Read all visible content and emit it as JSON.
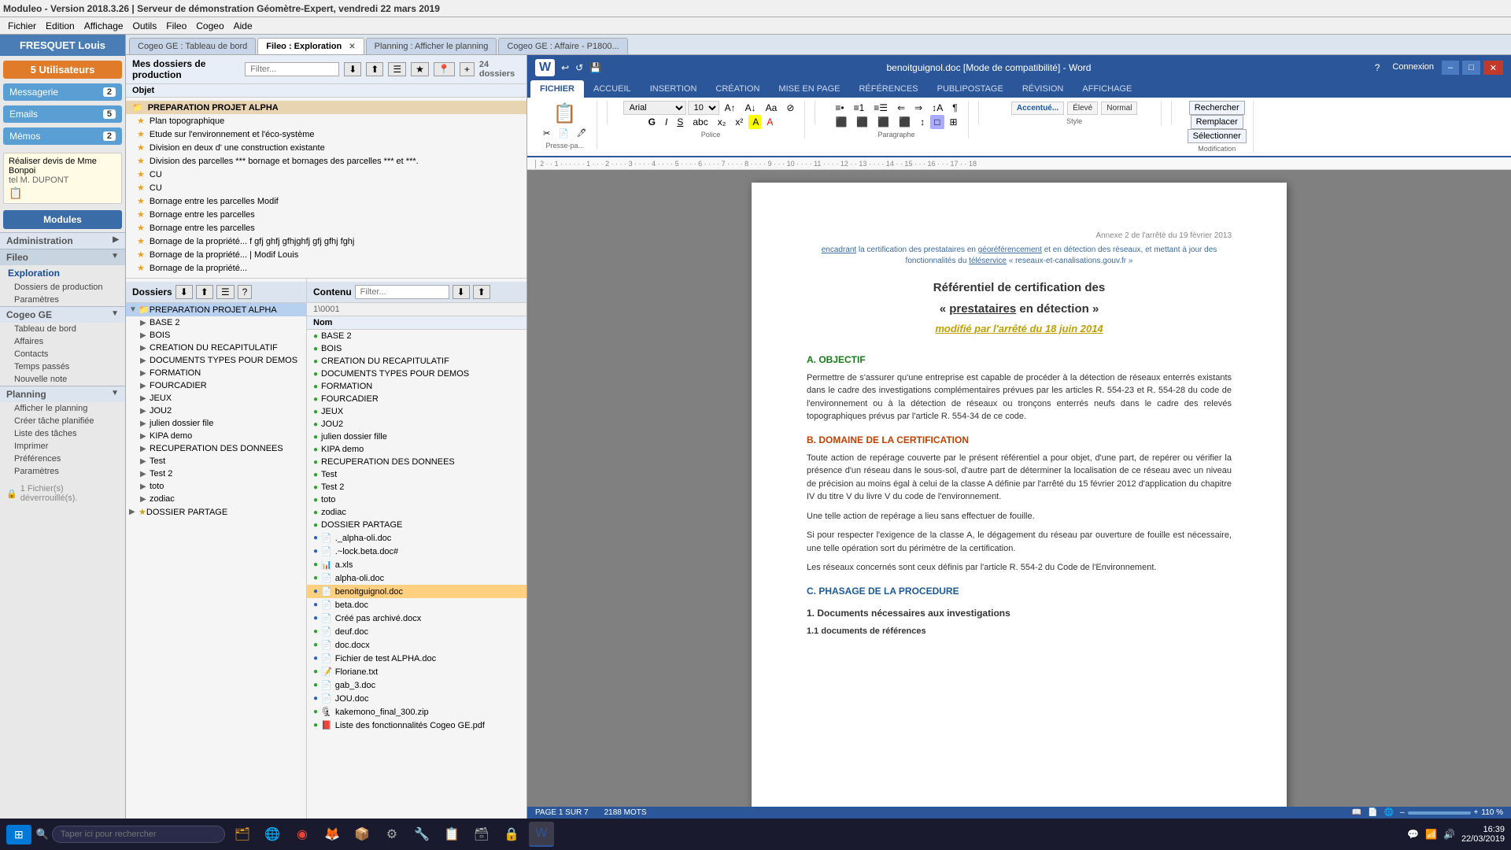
{
  "app": {
    "title": "Moduleo - Version 2018.3.26 | Serveur de démonstration Géomètre-Expert, vendredi 22 mars 2019",
    "menu": [
      "Fichier",
      "Edition",
      "Affichage",
      "Outils",
      "Fileo",
      "Cogeo",
      "Aide"
    ]
  },
  "tabs": [
    {
      "label": "Cogeo GE : Tableau de bord",
      "active": false,
      "closable": false
    },
    {
      "label": "Fileo : Exploration",
      "active": true,
      "closable": true
    },
    {
      "label": "Planning : Afficher le planning",
      "active": false,
      "closable": false
    },
    {
      "label": "Cogeo GE : Affaire - P1800...",
      "active": false,
      "closable": false
    }
  ],
  "sidebar": {
    "user": {
      "name": "FRESQUET Louis"
    },
    "utilisateurs": {
      "label": "5 Utilisateurs",
      "count": "5"
    },
    "messagerie": {
      "label": "Messagerie",
      "count": "2"
    },
    "emails": {
      "label": "Emails",
      "count": "5"
    },
    "memos": {
      "label": "Mémos",
      "count": "2"
    },
    "memo_content": "Réaliser devis de Mme Bonpoi\nM. DUPONT",
    "modules_label": "Modules",
    "administration": {
      "label": "Administration"
    },
    "fileo_section": {
      "label": "Fileo",
      "items": [
        "Exploration",
        "Dossiers de production",
        "Paramètres"
      ]
    },
    "cogeo_section": {
      "label": "Cogeo GE",
      "items": [
        "Tableau de bord",
        "Affaires",
        "Contacts",
        "Temps passés",
        "Nouvelle note"
      ]
    },
    "planning_section": {
      "label": "Planning",
      "items": [
        "Afficher le planning",
        "Créer tâche planifiée",
        "Liste des tâches",
        "Imprimer",
        "Préférences",
        "Paramètres"
      ]
    }
  },
  "file_panel": {
    "header": "Mes dossiers de production",
    "filter_placeholder": "Filter...",
    "dossiers_count": "24 dossiers",
    "productions": [
      {
        "type": "folder",
        "name": "PREPARATION PROJET ALPHA",
        "is_title": true
      },
      {
        "type": "star",
        "name": "Plan topographique"
      },
      {
        "type": "star",
        "name": "Etude sur l'environnement et l'éco-système"
      },
      {
        "type": "star",
        "name": "Division en deux d'  une construction existante"
      },
      {
        "type": "star",
        "name": "Division des parcelles *** bornage et bornages des parcelles *** et ***."
      },
      {
        "type": "star",
        "name": "CU"
      },
      {
        "type": "star",
        "name": "CU"
      },
      {
        "type": "star",
        "name": "Bornage entre les parcelles Modif"
      },
      {
        "type": "star",
        "name": "Bornage entre les parcelles"
      },
      {
        "type": "star",
        "name": "Bornage entre les parcelles"
      },
      {
        "type": "star",
        "name": "Bornage de la propriété... f gfj ghfj gfhjghfj gfj gfhj fghj"
      },
      {
        "type": "star",
        "name": "Bornage de la propriété...  | Modif Louis"
      },
      {
        "type": "star",
        "name": "Bornage de la propriété..."
      }
    ],
    "tree": {
      "header": "Dossiers",
      "items": [
        {
          "name": "PREPARATION PROJET ALPHA",
          "level": 0,
          "expanded": true,
          "selected": true
        },
        {
          "name": "BASE 2",
          "level": 1,
          "expanded": false
        },
        {
          "name": "BOIS",
          "level": 1,
          "expanded": false
        },
        {
          "name": "CREATION DU RECAPITULATIF",
          "level": 1,
          "expanded": false
        },
        {
          "name": "DOCUMENTS TYPES POUR DEMOS",
          "level": 1,
          "expanded": false
        },
        {
          "name": "FORMATION",
          "level": 1,
          "expanded": false
        },
        {
          "name": "FOURCADIER",
          "level": 1,
          "expanded": false
        },
        {
          "name": "JEUX",
          "level": 1,
          "expanded": false
        },
        {
          "name": "JOU2",
          "level": 1,
          "expanded": false
        },
        {
          "name": "julien dossier file",
          "level": 1,
          "expanded": false
        },
        {
          "name": "KIPA demo",
          "level": 1,
          "expanded": false
        },
        {
          "name": "RECUPERATION DES DONNEES",
          "level": 1,
          "expanded": false
        },
        {
          "name": "Test",
          "level": 1,
          "expanded": false
        },
        {
          "name": "Test 2",
          "level": 1,
          "expanded": false
        },
        {
          "name": "toto",
          "level": 1,
          "expanded": false
        },
        {
          "name": "zodiac",
          "level": 1,
          "expanded": false
        },
        {
          "name": "DOSSIER PARTAGE",
          "level": 0,
          "expanded": false
        }
      ]
    },
    "content": {
      "header": "Contenu",
      "filter_placeholder": "Filter...",
      "path": "1\\0001",
      "files": [
        {
          "name": "BASE 2",
          "type": "folder",
          "dot": "green"
        },
        {
          "name": "BOIS",
          "type": "folder",
          "dot": "green"
        },
        {
          "name": "CREATION DU RECAPITULATIF",
          "type": "folder",
          "dot": "green"
        },
        {
          "name": "DOCUMENTS TYPES POUR DEMOS",
          "type": "folder",
          "dot": "green"
        },
        {
          "name": "FORMATION",
          "type": "folder",
          "dot": "green"
        },
        {
          "name": "FOURCADIER",
          "type": "folder",
          "dot": "green"
        },
        {
          "name": "JEUX",
          "type": "folder",
          "dot": "green"
        },
        {
          "name": "JOU2",
          "type": "folder",
          "dot": "green"
        },
        {
          "name": "julien dossier fille",
          "type": "folder",
          "dot": "green"
        },
        {
          "name": "KIPA demo",
          "type": "folder",
          "dot": "green"
        },
        {
          "name": "RECUPERATION DES DONNEES",
          "type": "folder",
          "dot": "green"
        },
        {
          "name": "Test",
          "type": "folder",
          "dot": "green"
        },
        {
          "name": "Test 2",
          "type": "folder",
          "dot": "green"
        },
        {
          "name": "toto",
          "type": "folder",
          "dot": "green"
        },
        {
          "name": "zodiac",
          "type": "folder",
          "dot": "green"
        },
        {
          "name": "DOSSIER PARTAGE",
          "type": "folder",
          "dot": "green"
        },
        {
          "name": "._alpha-oli.doc",
          "type": "doc",
          "dot": "blue"
        },
        {
          "name": ".~lock.beta.doc#",
          "type": "doc",
          "dot": "blue"
        },
        {
          "name": "a.xls",
          "type": "xls",
          "dot": "green"
        },
        {
          "name": "alpha-oli.doc",
          "type": "doc",
          "dot": "green"
        },
        {
          "name": "benoitguignol.doc",
          "type": "doc",
          "dot": "blue",
          "selected": true
        },
        {
          "name": "beta.doc",
          "type": "doc",
          "dot": "blue"
        },
        {
          "name": "Créé pas archivé.docx",
          "type": "doc",
          "dot": "blue"
        },
        {
          "name": "deuf.doc",
          "type": "doc",
          "dot": "green"
        },
        {
          "name": "doc.docx",
          "type": "doc",
          "dot": "green"
        },
        {
          "name": "Fichier de test ALPHA.doc",
          "type": "doc",
          "dot": "blue"
        },
        {
          "name": "Floriane.txt",
          "type": "txt",
          "dot": "green"
        },
        {
          "name": "gab_3.doc",
          "type": "doc",
          "dot": "green"
        },
        {
          "name": "JOU.doc",
          "type": "doc",
          "dot": "blue"
        },
        {
          "name": "kakemono_final_300.zip",
          "type": "zip",
          "dot": "green"
        },
        {
          "name": "Liste des fonctionnalités Cogeo GE.pdf",
          "type": "pdf",
          "dot": "green"
        }
      ]
    }
  },
  "word": {
    "title": "benoitguignol.doc [Mode de compatibilité] - Word",
    "ribbon_tabs": [
      "FICHIER",
      "ACCUEIL",
      "INSERTION",
      "CRÉATION",
      "MISE EN PAGE",
      "RÉFÉRENCES",
      "PUBLIPOSTAGE",
      "RÉVISION",
      "AFFICHAGE"
    ],
    "active_tab": "FICHIER",
    "font": "Arial",
    "font_size": "10",
    "styles": [
      "Accentué...",
      "Élevé",
      "Normal"
    ],
    "search_label": "Rechercher",
    "replace_label": "Remplacer",
    "select_label": "Sélectionner",
    "document": {
      "annexe": "Annexe 2 de l'arrêté du 19 février 2013",
      "subtitle": "encadrant la certification des prestataires en géoréférencement et en détection des réseaux, et mettant à jour des fonctionnalités du téléservice « reseaux-et-canalisations.gouv.fr »",
      "title1": "Référentiel de certification des",
      "title2": "« prestataires en détection »",
      "modified": "modifié par l'arrêté du 18 juin 2014",
      "section_a": "A.  OBJECTIF",
      "para_a": "Permettre de s'assurer qu'une entreprise est capable de procéder à la détection de réseaux enterrés existants dans le cadre des investigations complémentaires prévues par les articles R. 554-23 et R. 554-28 du code de l'environnement ou à la détection de réseaux ou tronçons enterrés neufs dans le cadre des relevés topographiques prévus par l'article R. 554-34 de ce code.",
      "section_b": "B.  DOMAINE DE LA CERTIFICATION",
      "para_b": "Toute action de repérage couverte par le présent référentiel a pour objet, d'une part, de repérer ou vérifier la présence d'un réseau dans le sous-sol, d'autre part de déterminer la localisation de ce réseau avec un niveau de précision au moins égal à celui de la classe A définie par l'arrêté du 15 février 2012 d'application du chapitre IV du titre V du livre V du code de l'environnement.",
      "para_b2": "Une telle action de repérage a lieu sans effectuer de fouille.",
      "para_b3": "Si pour respecter l'exigence de la classe A, le dégagement du réseau par ouverture de fouille est nécessaire, une telle opération sort du périmètre de la certification.",
      "para_b4": "Les réseaux concernés sont ceux définis par l'article R. 554-2 du Code de l'Environnement.",
      "section_c": "C.  PHASAGE DE LA PROCEDURE",
      "num1": "1.   Documents nécessaires aux investigations",
      "sub1": "1.1 documents de références"
    },
    "status": {
      "page": "PAGE 1 SUR 7",
      "words": "2188 MOTS",
      "zoom": "110 %"
    }
  },
  "taskbar": {
    "search_placeholder": "Taper ici pour rechercher",
    "time": "16:39",
    "date": "22/03/2019"
  }
}
